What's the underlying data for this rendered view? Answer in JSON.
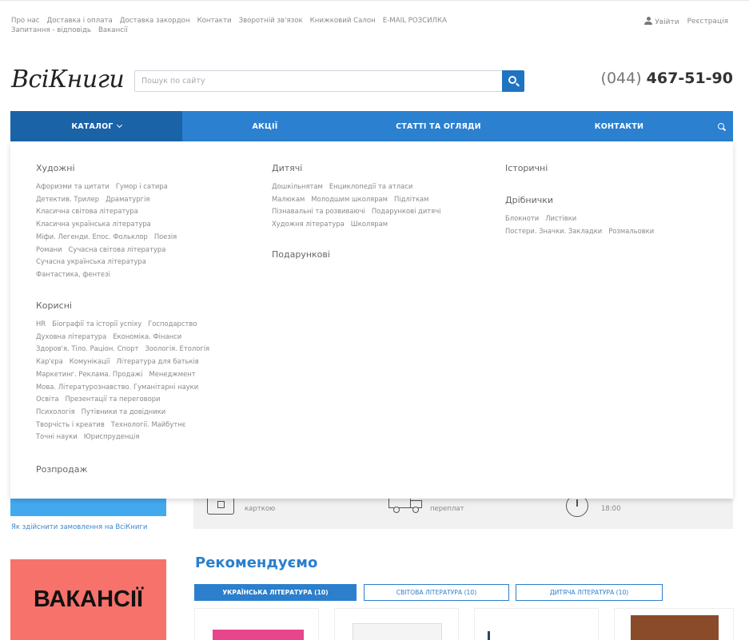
{
  "topbar": {
    "links": [
      "Про нас",
      "Доставка і оплата",
      "Доставка закордон",
      "Контакти",
      "Зворотній зв'язок",
      "Книжковий Салон",
      "E-MAIL РОЗСИЛКА",
      "Запитання - відповідь",
      "Вакансії"
    ],
    "login": "Увійти",
    "register": "Реєстрація"
  },
  "header": {
    "logo": "ВсiКниги",
    "search_placeholder": "Пошук по сайту",
    "phone_code": "(044)",
    "phone_number": "467-51-90"
  },
  "nav": {
    "catalog": "КАТАЛОГ",
    "akcii": "АКЦІЇ",
    "statti": "СТАТТІ ТА ОГЛЯДИ",
    "kontakty": "КОНТАКТИ"
  },
  "mega": {
    "khudozhni": {
      "title": "Художні",
      "links": [
        "Афоризми та цитати",
        "Гумор і сатира",
        "Детектив. Трилер",
        "Драматургія",
        "Класична світова література",
        "Класична українська література",
        "Міфи. Легенди. Епос. Фольклор",
        "Поезія",
        "Романи",
        "Сучасна світова література",
        "Сучасна українська література",
        "Фантастика, фентезі"
      ]
    },
    "dytiachi": {
      "title": "Дитячі",
      "links": [
        "Дошкільнятам",
        "Енциклопедії та атласи",
        "Малюкам",
        "Молодшим школярам",
        "Підліткам",
        "Пізнавальні та розвиваючі",
        "Подарункові дитячі",
        "Художня література",
        "Школярам"
      ]
    },
    "podarunkovi": {
      "title": "Подарункові"
    },
    "istorychni": {
      "title": "Історичні"
    },
    "dribnychky": {
      "title": "Дрібнички",
      "links": [
        "Блокноти",
        "Листівки",
        "Постери. Значки. Закладки",
        "Розмальовки"
      ]
    },
    "korysni": {
      "title": "Корисні",
      "links": [
        "HR",
        "Біографії та історії успіху",
        "Господарство",
        "Духовна література",
        "Економіка. Фінанси",
        "Здоров'я. Тіло. Раціон. Спорт",
        "Зоологія. Етологія",
        "Кар'єра",
        "Комунікації",
        "Література для батьків",
        "Маркетинг. Реклама. Продажі",
        "Менеджмент",
        "Мова. Літературознавство. Гуманітарні науки",
        "Освіта",
        "Презентації та переговори",
        "Психологія",
        "Путівники та довідники",
        "Творчість і креатив",
        "Технології. Майбутнє",
        "Точні науки",
        "Юриспруденція"
      ]
    },
    "rozprodazh": {
      "title": "Розпродаж"
    }
  },
  "features": {
    "card": "карткою",
    "delivery": "переплат",
    "hours": "18:00"
  },
  "side_link": "Як здійснити замовлення на ВсіКниги",
  "vacancy": "ВАКАНСІЇ",
  "recommend": {
    "title": "Рекомендуємо",
    "tabs": [
      "УКРАЇНСЬКА ЛІТЕРАТУРА (10)",
      "СВІТОВА ЛІТЕРАТУРА (10)",
      "ДИТЯЧА ЛІТЕРАТУРА (10)"
    ]
  },
  "colors": {
    "accent": "#2b80cf",
    "nav_active": "#1b63a7",
    "vacancy_bg": "#f7726b"
  }
}
